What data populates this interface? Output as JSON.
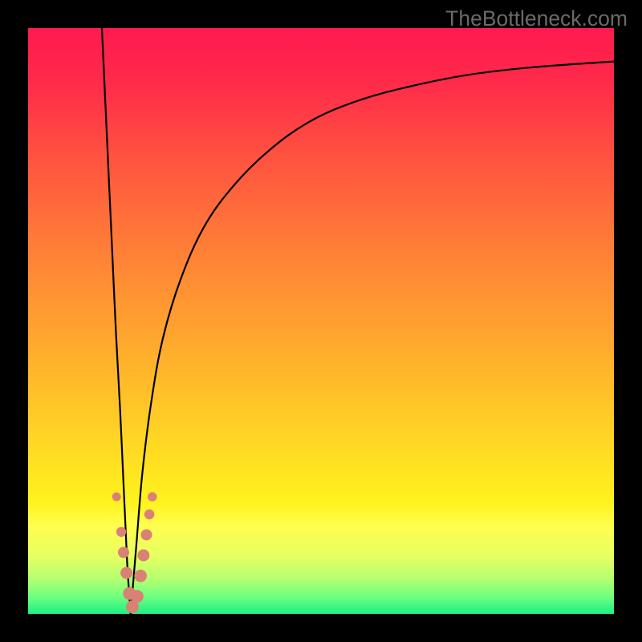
{
  "watermark": "TheBottleneck.com",
  "colors": {
    "gradient_stops": [
      {
        "offset": 0.0,
        "color": "#ff1a4f"
      },
      {
        "offset": 0.09,
        "color": "#ff2a4a"
      },
      {
        "offset": 0.22,
        "color": "#ff5240"
      },
      {
        "offset": 0.36,
        "color": "#ff7a38"
      },
      {
        "offset": 0.5,
        "color": "#ff9f30"
      },
      {
        "offset": 0.63,
        "color": "#ffc228"
      },
      {
        "offset": 0.74,
        "color": "#ffe022"
      },
      {
        "offset": 0.81,
        "color": "#fff31e"
      },
      {
        "offset": 0.85,
        "color": "#fffe50"
      },
      {
        "offset": 0.9,
        "color": "#e8ff60"
      },
      {
        "offset": 0.94,
        "color": "#b4ff70"
      },
      {
        "offset": 0.97,
        "color": "#70ff80"
      },
      {
        "offset": 1.0,
        "color": "#1cef82"
      }
    ],
    "curve": "#000000",
    "marker_fill": "#d98174",
    "marker_stroke": "#c86a5d"
  },
  "chart_data": {
    "type": "line",
    "title": "",
    "xlabel": "",
    "ylabel": "",
    "xlim": [
      0,
      100
    ],
    "ylim": [
      0,
      100
    ],
    "series": [
      {
        "name": "left-branch",
        "x": [
          12.6,
          13.2,
          13.8,
          14.4,
          15.0,
          15.7,
          16.3,
          16.9,
          17.5
        ],
        "y": [
          100.0,
          87.0,
          74.0,
          61.0,
          48.0,
          35.0,
          22.0,
          9.0,
          0.0
        ]
      },
      {
        "name": "right-branch",
        "x": [
          17.5,
          18.5,
          19.5,
          21.0,
          23.0,
          26.0,
          30.0,
          35.0,
          41.0,
          48.0,
          56.0,
          65.0,
          75.0,
          86.0,
          100.0
        ],
        "y": [
          0.0,
          12.0,
          24.0,
          36.0,
          47.0,
          57.0,
          66.0,
          73.0,
          79.0,
          84.0,
          87.5,
          90.0,
          92.0,
          93.3,
          94.3
        ]
      }
    ],
    "markers": {
      "name": "bottleneck-points",
      "points": [
        {
          "x": 15.1,
          "y": 20.0,
          "r": 5.5
        },
        {
          "x": 15.9,
          "y": 14.0,
          "r": 6.2
        },
        {
          "x": 16.3,
          "y": 10.5,
          "r": 7.0
        },
        {
          "x": 16.8,
          "y": 7.0,
          "r": 7.5
        },
        {
          "x": 17.3,
          "y": 3.5,
          "r": 8.0
        },
        {
          "x": 17.8,
          "y": 1.2,
          "r": 8.0
        },
        {
          "x": 18.6,
          "y": 3.0,
          "r": 8.0
        },
        {
          "x": 19.2,
          "y": 6.5,
          "r": 7.8
        },
        {
          "x": 19.7,
          "y": 10.0,
          "r": 7.5
        },
        {
          "x": 20.2,
          "y": 13.5,
          "r": 7.0
        },
        {
          "x": 20.7,
          "y": 17.0,
          "r": 6.3
        },
        {
          "x": 21.2,
          "y": 20.0,
          "r": 5.8
        }
      ]
    }
  }
}
